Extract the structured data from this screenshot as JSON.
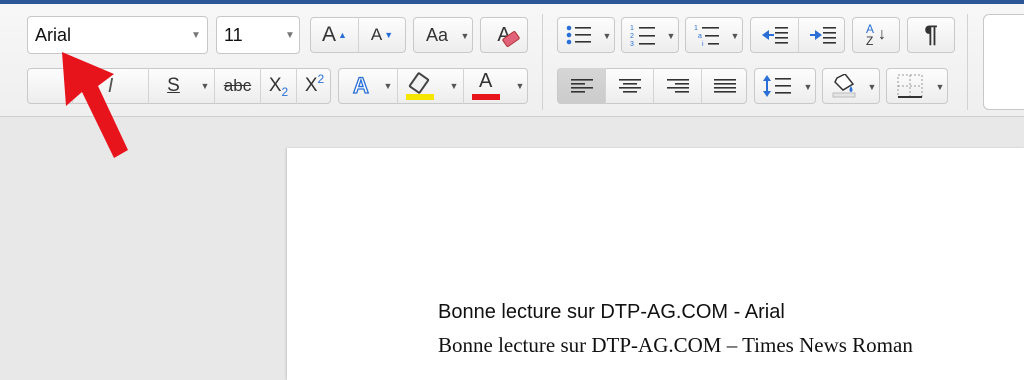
{
  "ribbon": {
    "font_name": "Arial",
    "font_size": "11",
    "grow_font_label": "A",
    "shrink_font_label": "A",
    "case_label": "Aa",
    "clear_label": "A",
    "underline_label": "S",
    "strike_label": "abc",
    "subscript_label": "X",
    "subscript_mark": "2",
    "superscript_label": "X",
    "superscript_mark": "2",
    "effects_label": "A",
    "font_color_label": "A",
    "highlight_color": "#f5e600",
    "font_color": "#e8141c",
    "sort_top": "A",
    "sort_bottom": "Z",
    "pilcrow": "¶",
    "numbering_marks": [
      "1",
      "2",
      "3"
    ],
    "multilevel_marks": [
      "1",
      "a",
      "i"
    ]
  },
  "document": {
    "line1": "Bonne lecture sur DTP-AG.COM - Arial",
    "line2": "Bonne lecture sur DTP-AG.COM – Times News Roman"
  },
  "annotation": {
    "arrow_color": "#e8141c"
  }
}
